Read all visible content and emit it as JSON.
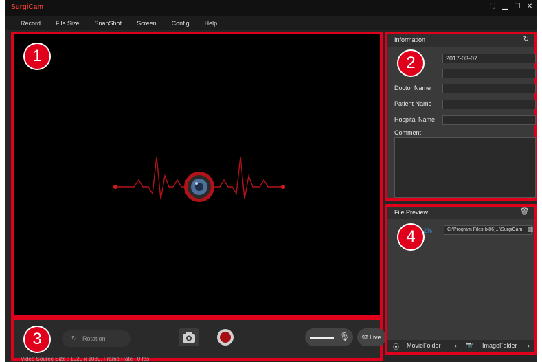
{
  "app": {
    "title": "SurgiCam",
    "window_controls": [
      "⛶",
      "▁",
      "☐",
      "✕"
    ]
  },
  "menu": {
    "items": [
      "Record",
      "File Size",
      "SnapShot",
      "Screen",
      "Config",
      "Help"
    ]
  },
  "callouts": [
    "1",
    "2",
    "3",
    "4"
  ],
  "information": {
    "title": "Information",
    "refresh_icon": "↻",
    "date_value": "2017-03-07",
    "doctor_label": "Doctor Name",
    "patient_label": "Patient Name",
    "hospital_label": "Hospital Name",
    "comment_label": "Comment"
  },
  "controls": {
    "rotation_label": "Rotation",
    "rotation_icon": "↻",
    "camera_icon": "📷",
    "mic_icon": "🎙",
    "live_label": "Live",
    "live_icon": "👁",
    "status": "Video Source Size : 1920 x 1080, Frame Rate : 0 fps"
  },
  "preview": {
    "title": "File Preview",
    "trash_icon": "🗑",
    "percent": "2%",
    "path": "C:\\Program Files (x86)...\\SurgiCam",
    "folder_icon": "▤",
    "movie_label": "MovieFolder",
    "image_label": "ImageFolder",
    "movie_icon": "⦿",
    "image_icon": "📷",
    "chevron": "›"
  },
  "colors": {
    "accent": "#e0001b",
    "pulse": "#b3121a"
  }
}
